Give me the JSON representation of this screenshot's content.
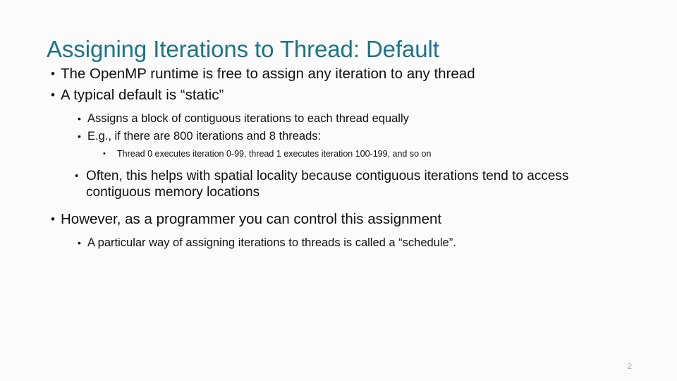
{
  "slide": {
    "title": "Assigning Iterations to Thread: Default",
    "title_color": "#1b7489",
    "background_color": "#fbfbfb",
    "body_text_color": "#101010",
    "page_number": "2",
    "page_number_color": "#a6a6a6",
    "bullet_marker": "•",
    "content": [
      {
        "level": 1,
        "marker": "•",
        "text": "The OpenMP runtime is free to assign any iteration to any thread"
      },
      {
        "level": 1,
        "marker": "•",
        "text": "A typical default is “static”"
      },
      {
        "level": 2,
        "marker": "•",
        "text": "Assigns a block of contiguous iterations to each thread equally"
      },
      {
        "level": 2,
        "marker": "•",
        "text": "E.g., if there are 800 iterations and 8 threads:"
      },
      {
        "level": 3,
        "marker": "•",
        "text": "Thread 0 executes iteration 0-99, thread 1 executes iteration 100-199, and so on"
      },
      {
        "level": 2,
        "marker": "•",
        "text": "Often, this helps with spatial locality because contiguous iterations tend to access contiguous memory locations"
      },
      {
        "level": 1,
        "marker": "•",
        "text": "However, as a programmer you can control this assignment"
      },
      {
        "level": 2,
        "marker": "•",
        "text": "A particular way of assigning iterations to threads is called a “schedule”."
      }
    ]
  }
}
